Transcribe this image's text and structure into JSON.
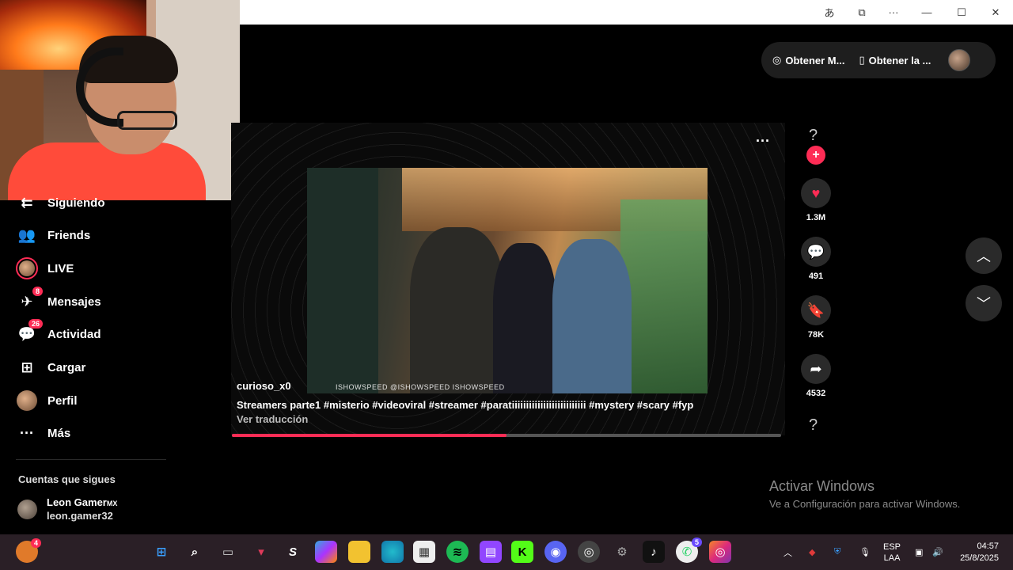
{
  "titlebar": {
    "icons": [
      "translate-icon",
      "extension-icon",
      "more-icon",
      "minimize-icon",
      "maximize-icon",
      "close-icon"
    ],
    "glyphs": [
      "あ",
      "⧉",
      "···",
      "—",
      "☐",
      "✕"
    ]
  },
  "sidebar": {
    "items": [
      {
        "label": "Siguiendo",
        "icon": "following-icon",
        "glyph": "⇇"
      },
      {
        "label": "Friends",
        "icon": "friends-icon",
        "glyph": "👥"
      },
      {
        "label": "LIVE",
        "icon": "live-avatar-icon",
        "glyph": ""
      },
      {
        "label": "Mensajes",
        "icon": "messages-icon",
        "glyph": "✈",
        "badge": "8"
      },
      {
        "label": "Actividad",
        "icon": "activity-icon",
        "glyph": "💬",
        "badge": "26"
      },
      {
        "label": "Cargar",
        "icon": "upload-icon",
        "glyph": "⊞"
      },
      {
        "label": "Perfil",
        "icon": "profile-avatar-icon",
        "glyph": ""
      },
      {
        "label": "Más",
        "icon": "more-icon",
        "glyph": "···"
      }
    ],
    "following_title": "Cuentas que sigues",
    "followed": {
      "name": "Leon Gamer",
      "name_suffix": "MX",
      "handle": "leon.gamer32"
    }
  },
  "topbar": {
    "get_coins": "Obtener M...",
    "get_app": "Obtener la ..."
  },
  "video": {
    "user": "curioso_x0",
    "description": "Streamers parte1 #misterio #videoviral #streamer #paratiiiiiiiiiiiiiiiiiiiiiiiiii #mystery #scary #fyp",
    "translate": "Ver traducción",
    "watermark": "ISHOWSPEED  @ISHOWSPEED  ISHOWSPEED",
    "progress": 0.5
  },
  "actions": {
    "likes": "1.3M",
    "comments": "491",
    "saves": "78K",
    "shares": "4532"
  },
  "watermark_windows": {
    "title": "Activar Windows",
    "subtitle": "Ve a Configuración para activar Windows."
  },
  "taskbar": {
    "lang": "ESP",
    "lang_sub": "LAA",
    "time": "04:57",
    "date": "25/8/2025",
    "weather_badge": "4",
    "whatsapp_badge": "5"
  },
  "colors": {
    "accent": "#fe2c55"
  }
}
